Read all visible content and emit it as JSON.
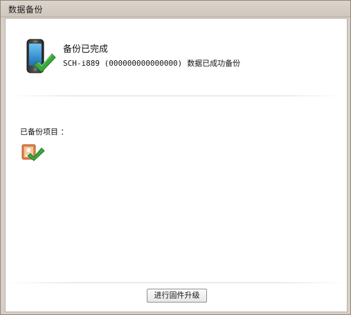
{
  "window": {
    "title": "数据备份"
  },
  "status": {
    "title": "备份已完成",
    "device": "SCH-i889 (000000000000000)",
    "message": "数据已成功备份"
  },
  "backup_items": {
    "label": "已备份项目 ：",
    "items": [
      {
        "icon": "contacts-icon",
        "checked": true
      }
    ]
  },
  "footer": {
    "upgrade_button_label": "进行固件升级"
  },
  "colors": {
    "titlebar": "#d7cfc6",
    "content_bg": "#ffffff",
    "check_green": "#3aa83a",
    "contact_orange": "#e0834a"
  },
  "icons": {
    "status_icon": "phone-check-icon"
  }
}
